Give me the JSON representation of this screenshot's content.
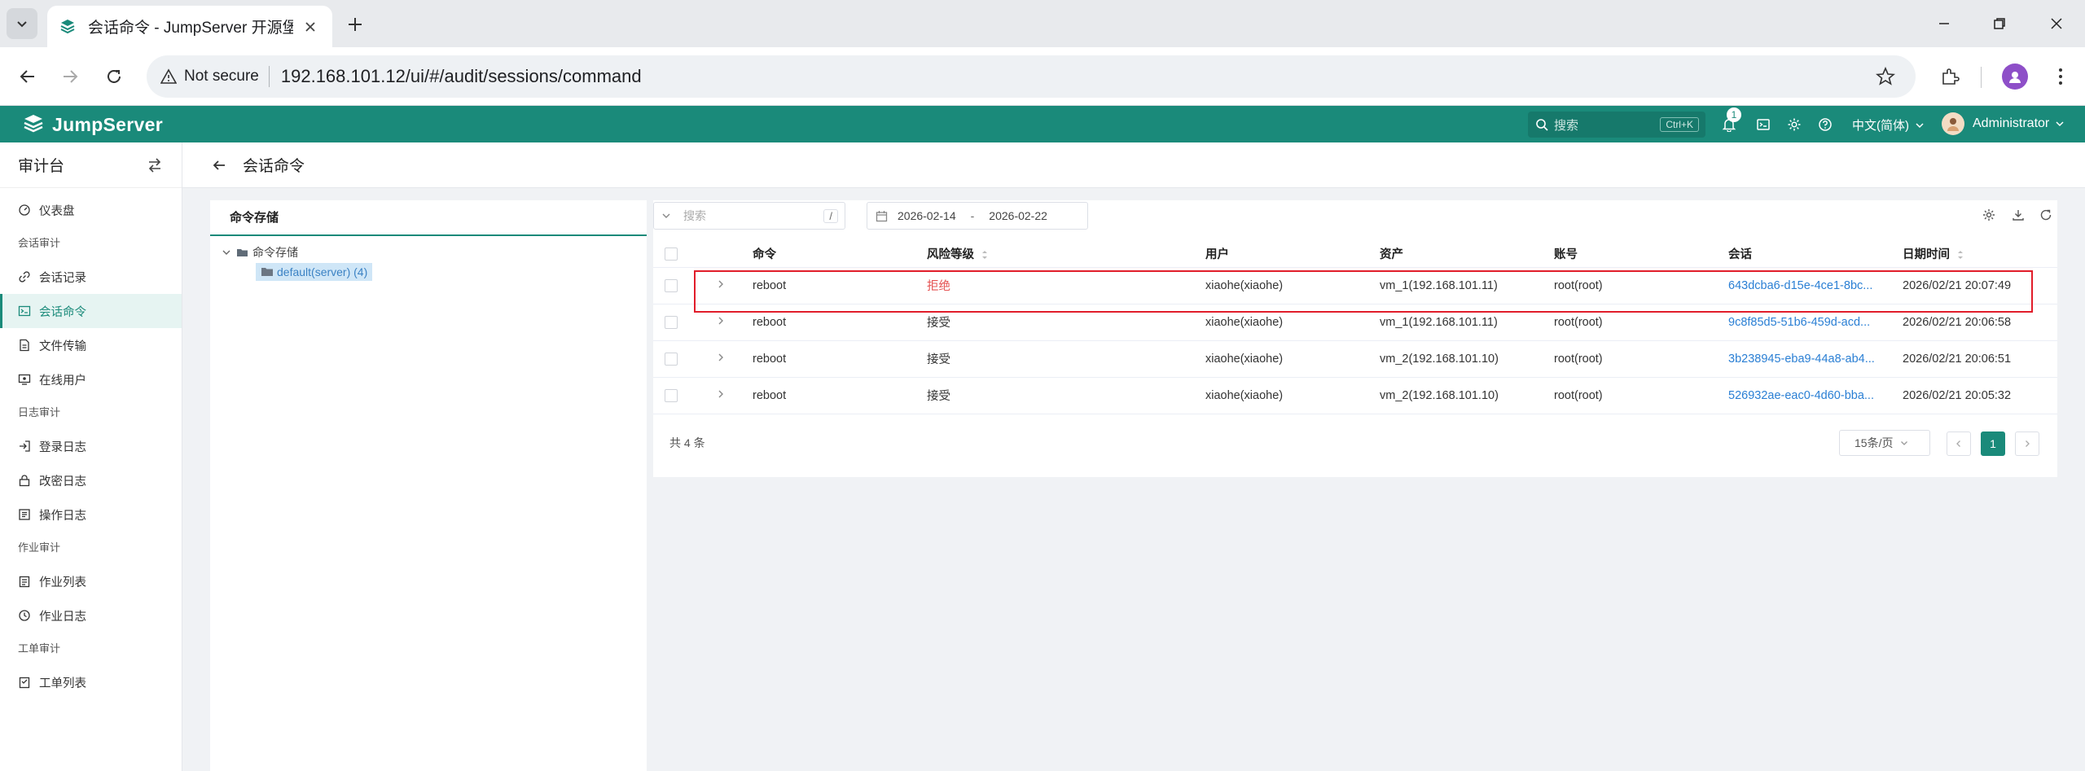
{
  "browser": {
    "tab_title": "会话命令 - JumpServer 开源堡垒机",
    "security_label": "Not secure",
    "url": "192.168.101.12/ui/#/audit/sessions/command"
  },
  "header": {
    "logo": "JumpServer",
    "search_placeholder": "搜索",
    "search_shortcut": "Ctrl+K",
    "notification_count": "1",
    "language": "中文(简体)",
    "user": "Administrator"
  },
  "sidebar": {
    "title": "审计台",
    "items": [
      {
        "type": "item",
        "label": "仪表盘",
        "icon": "dashboard-icon"
      },
      {
        "type": "group",
        "label": "会话审计"
      },
      {
        "type": "item",
        "label": "会话记录",
        "icon": "link-icon"
      },
      {
        "type": "item",
        "label": "会话命令",
        "icon": "terminal-icon",
        "active": true
      },
      {
        "type": "item",
        "label": "文件传输",
        "icon": "file-icon"
      },
      {
        "type": "item",
        "label": "在线用户",
        "icon": "online-user-icon"
      },
      {
        "type": "group",
        "label": "日志审计"
      },
      {
        "type": "item",
        "label": "登录日志",
        "icon": "login-icon"
      },
      {
        "type": "item",
        "label": "改密日志",
        "icon": "password-icon"
      },
      {
        "type": "item",
        "label": "操作日志",
        "icon": "operation-icon"
      },
      {
        "type": "group",
        "label": "作业审计"
      },
      {
        "type": "item",
        "label": "作业列表",
        "icon": "job-list-icon"
      },
      {
        "type": "item",
        "label": "作业日志",
        "icon": "job-log-icon"
      },
      {
        "type": "group",
        "label": "工单审计"
      },
      {
        "type": "item",
        "label": "工单列表",
        "icon": "ticket-icon"
      }
    ]
  },
  "page": {
    "title": "会话命令"
  },
  "tree": {
    "tab": "命令存储",
    "root": "命令存储",
    "child": "default(server) (4)"
  },
  "filters": {
    "search_placeholder": "搜索",
    "search_shortcut": "/",
    "date_start": "2026-02-14",
    "date_sep": "-",
    "date_end": "2026-02-22"
  },
  "table": {
    "columns": [
      "命令",
      "风险等级",
      "用户",
      "资产",
      "账号",
      "会话",
      "日期时间"
    ],
    "rows": [
      {
        "command": "reboot",
        "risk": "拒绝",
        "risk_level": "deny",
        "user": "xiaohe(xiaohe)",
        "asset": "vm_1(192.168.101.11)",
        "account": "root(root)",
        "session": "643dcba6-d15e-4ce1-8bc...",
        "datetime": "2026/02/21 20:07:49"
      },
      {
        "command": "reboot",
        "risk": "接受",
        "risk_level": "accept",
        "user": "xiaohe(xiaohe)",
        "asset": "vm_1(192.168.101.11)",
        "account": "root(root)",
        "session": "9c8f85d5-51b6-459d-acd...",
        "datetime": "2026/02/21 20:06:58"
      },
      {
        "command": "reboot",
        "risk": "接受",
        "risk_level": "accept",
        "user": "xiaohe(xiaohe)",
        "asset": "vm_2(192.168.101.10)",
        "account": "root(root)",
        "session": "3b238945-eba9-44a8-ab4...",
        "datetime": "2026/02/21 20:06:51"
      },
      {
        "command": "reboot",
        "risk": "接受",
        "risk_level": "accept",
        "user": "xiaohe(xiaohe)",
        "asset": "vm_2(192.168.101.10)",
        "account": "root(root)",
        "session": "526932ae-eac0-4d60-bba...",
        "datetime": "2026/02/21 20:05:32"
      }
    ]
  },
  "pagination": {
    "total": "共 4 条",
    "page_size": "15条/页",
    "current_page": "1"
  },
  "colors": {
    "brand": "#1a8a7a",
    "deny": "#e55353",
    "link": "#2a7fd4",
    "highlight": "#e11d2a"
  }
}
